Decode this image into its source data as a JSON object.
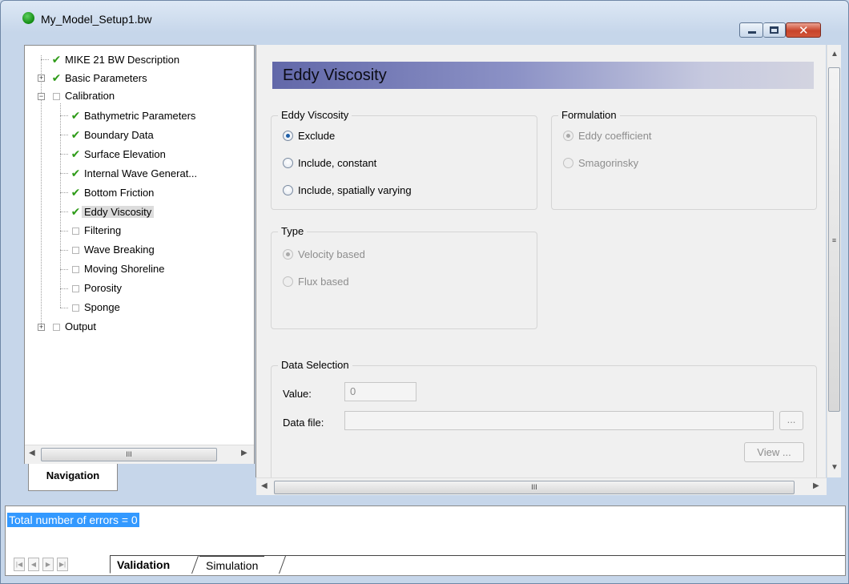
{
  "window": {
    "title": "My_Model_Setup1.bw",
    "minimize_glyph": "—",
    "maximize_glyph": "□",
    "close_glyph": "✕"
  },
  "navigation": {
    "tab_label": "Navigation",
    "tree": [
      {
        "label": "MIKE 21 BW Description",
        "status": "checked"
      },
      {
        "label": "Basic Parameters",
        "status": "checked",
        "expandable": "+"
      },
      {
        "label": "Calibration",
        "status": "unchecked",
        "expandable": "−"
      },
      {
        "label": "Bathymetric Parameters",
        "status": "checked"
      },
      {
        "label": "Boundary Data",
        "status": "checked"
      },
      {
        "label": "Surface Elevation",
        "status": "checked"
      },
      {
        "label": "Internal Wave Generat...",
        "status": "checked"
      },
      {
        "label": "Bottom Friction",
        "status": "checked"
      },
      {
        "label": "Eddy Viscosity",
        "status": "checked",
        "selected": "true"
      },
      {
        "label": "Filtering",
        "status": "unchecked"
      },
      {
        "label": "Wave Breaking",
        "status": "unchecked"
      },
      {
        "label": "Moving Shoreline",
        "status": "unchecked"
      },
      {
        "label": "Porosity",
        "status": "unchecked"
      },
      {
        "label": "Sponge",
        "status": "unchecked"
      },
      {
        "label": "Output",
        "status": "unchecked",
        "expandable": "+"
      }
    ],
    "scrollbar_thumb": "III"
  },
  "content": {
    "heading": "Eddy Viscosity",
    "eddy_group": {
      "title": "Eddy Viscosity",
      "options": [
        "Exclude",
        "Include, constant",
        "Include, spatially varying"
      ],
      "selected": "Exclude"
    },
    "formulation_group": {
      "title": "Formulation",
      "options": [
        "Eddy coefficient",
        "Smagorinsky"
      ],
      "selected": "Eddy coefficient"
    },
    "type_group": {
      "title": "Type",
      "options": [
        "Velocity based",
        "Flux based"
      ],
      "selected": "Velocity based"
    },
    "data_selection": {
      "title": "Data Selection",
      "value_label": "Value:",
      "value": "0",
      "datafile_label": "Data file:",
      "datafile_value": "",
      "browse_label": "...",
      "view_label": "View ..."
    },
    "hscroll_thumb": "III",
    "vscroll_thumb": "≡"
  },
  "output": {
    "error_text": "Total number of errors = 0",
    "tabs": [
      "Validation",
      "Simulation"
    ],
    "active_tab": "Validation"
  },
  "colors": {
    "heading_gradient_start": "#6268a9",
    "check_green": "#2e9b18",
    "selection_blue": "#3399ff"
  }
}
